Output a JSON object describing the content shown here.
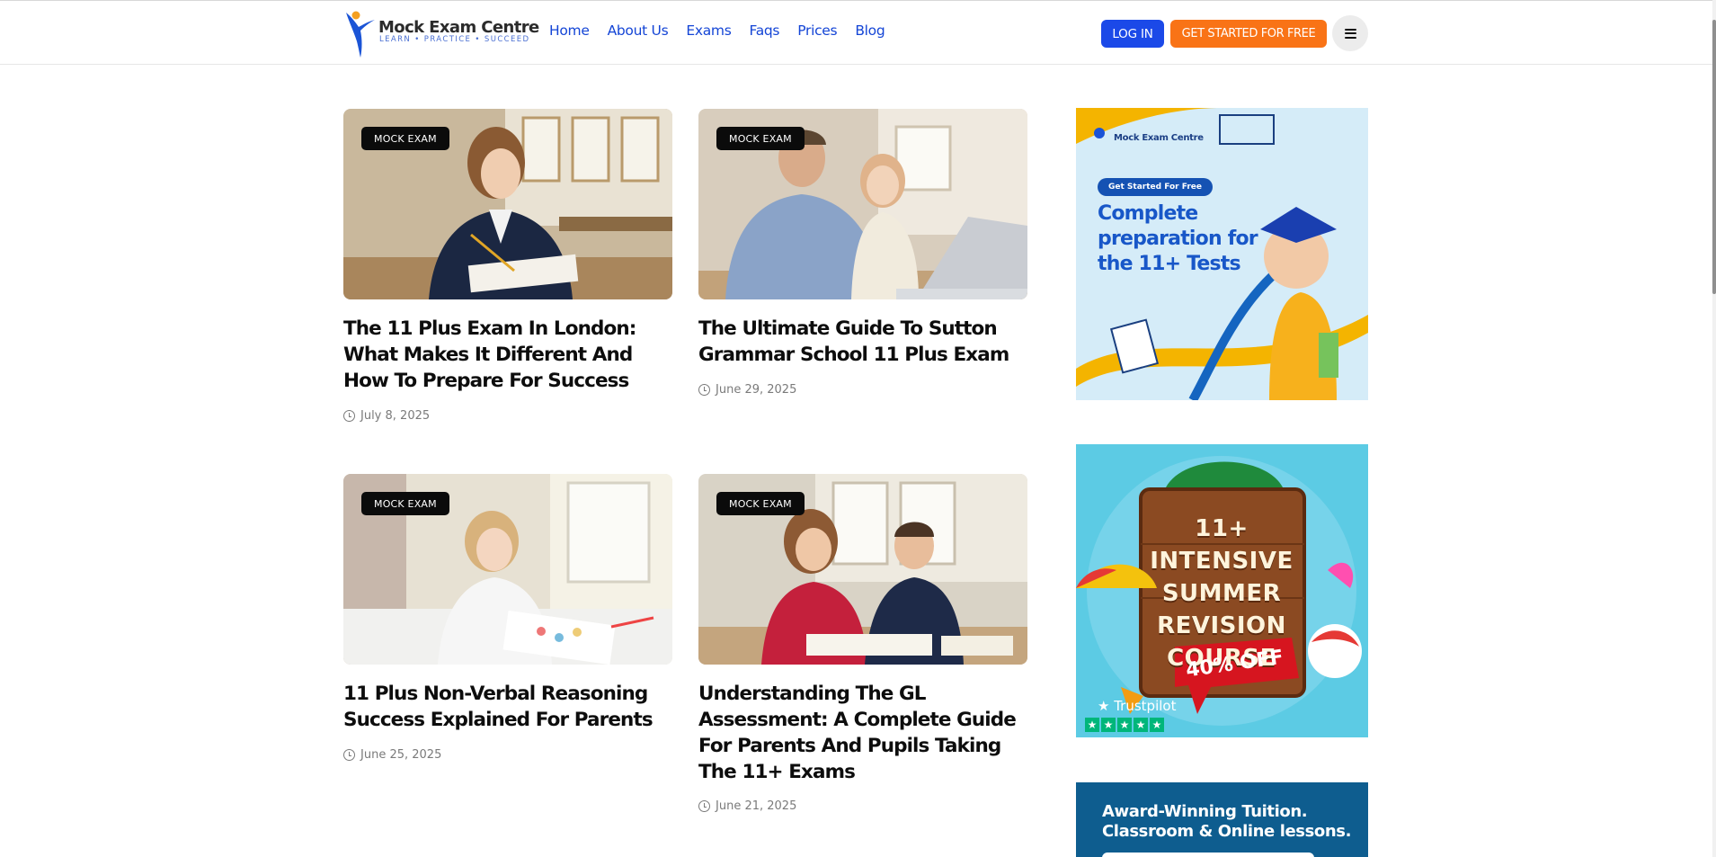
{
  "header": {
    "logo": {
      "name": "Mock Exam Centre",
      "tagline": "LEARN • PRACTICE • SUCCEED"
    },
    "nav": [
      {
        "label": "Home"
      },
      {
        "label": "About Us"
      },
      {
        "label": "Exams"
      },
      {
        "label": "Faqs"
      },
      {
        "label": "Prices"
      },
      {
        "label": "Blog"
      }
    ],
    "login_label": "LOG IN",
    "start_label": "GET STARTED FOR FREE",
    "menu_icon": "hamburger-icon"
  },
  "posts": [
    {
      "category": "MOCK EXAM",
      "title": "The 11 Plus Exam In London: What Makes It Different And How To Prepare For Success",
      "date": "July 8, 2025"
    },
    {
      "category": "MOCK EXAM",
      "title": "The Ultimate Guide To Sutton Grammar School 11 Plus Exam",
      "date": "June 29, 2025"
    },
    {
      "category": "MOCK EXAM",
      "title": "11 Plus Non-Verbal Reasoning Success Explained For Parents",
      "date": "June 25, 2025"
    },
    {
      "category": "MOCK EXAM",
      "title": "Understanding The GL Assessment: A Complete Guide For Parents And Pupils Taking The 11+ Exams",
      "date": "June 21, 2025"
    }
  ],
  "sidebar": {
    "ad1": {
      "logo": "Mock Exam Centre",
      "pill": "Get Started For Free",
      "headline": "Complete preparation for the 11+ Tests"
    },
    "ad2": {
      "line1": "11+ INTENSIVE",
      "line2": "SUMMER",
      "line3": "REVISION",
      "line4": "COURSE",
      "discount": "40% OFF",
      "trust": "★ Trustpilot"
    },
    "ad3": {
      "headline": "Award-Winning Tuition. Classroom & Online lessons."
    }
  },
  "colors": {
    "nav_link": "#1445d6",
    "login_button": "#1b49e8",
    "cta_button": "#f97316",
    "tag_bg": "#0b0b0b"
  }
}
